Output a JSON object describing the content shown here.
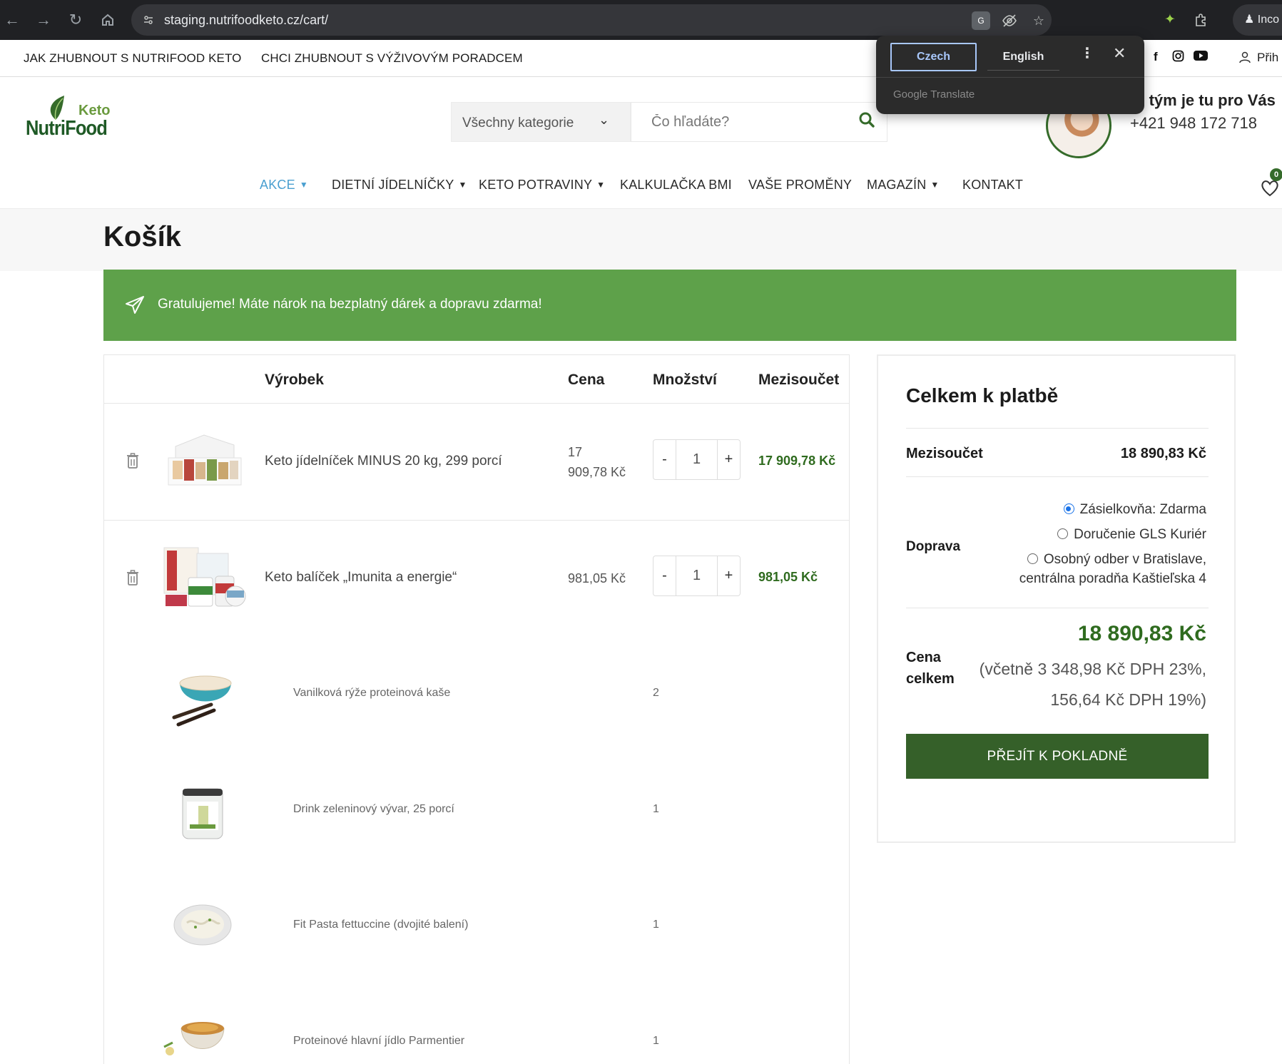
{
  "browser": {
    "url": "staging.nutrifoodketo.cz/cart/",
    "profile_label": "Inco"
  },
  "topbar": {
    "links": [
      "JAK ZHUBNOUT S NUTRIFOOD KETO",
      "CHCI ZHUBNOUT S VÝŽIVOVÝM PORADCEM"
    ],
    "login_label": "Přih"
  },
  "translate_popup": {
    "source_lang": "Czech",
    "target_lang": "English",
    "brand": "Google Translate"
  },
  "header": {
    "logo_keto": "Keto",
    "logo_brand": "NutriFood",
    "category_select": "Všechny kategorie",
    "search_placeholder": "Čo hľadáte?",
    "team_text": "aš tým je tu pro Vás",
    "phone": "+421 948 172 718",
    "wishlist_count": "0"
  },
  "nav": {
    "items": [
      {
        "label": "AKCE",
        "dropdown": true,
        "active": true
      },
      {
        "label": "DIETNÍ JÍDELNÍČKY",
        "dropdown": true
      },
      {
        "label": "KETO POTRAVINY",
        "dropdown": true
      },
      {
        "label": "KALKULAČKA BMI"
      },
      {
        "label": "VAŠE PROMĚNY"
      },
      {
        "label": "MAGAZÍN",
        "dropdown": true
      },
      {
        "label": "KONTAKT"
      }
    ]
  },
  "page": {
    "title": "Košík",
    "notice": "Gratulujeme! Máte nárok na bezplatný dárek a dopravu zdarma!"
  },
  "cart": {
    "headers": {
      "product": "Výrobek",
      "price": "Cena",
      "quantity": "Množství",
      "subtotal": "Mezisoučet"
    },
    "items": [
      {
        "name": "Keto jídelníček MINUS 20 kg, 299 porcí",
        "price_line1": "17",
        "price_line2": "909,78 Kč",
        "qty": "1",
        "subtotal": "17 909,78 Kč"
      },
      {
        "name": "Keto balíček „Imunita a energie“",
        "price": "981,05 Kč",
        "qty": "1",
        "subtotal": "981,05 Kč"
      }
    ],
    "bundle_items": [
      {
        "name": "Vanilková rýže proteinová kaše",
        "qty": "2"
      },
      {
        "name": "Drink zeleninový vývar, 25 porcí",
        "qty": "1"
      },
      {
        "name": "Fit Pasta fettuccine (dvojité balení)",
        "qty": "1"
      },
      {
        "name": "Proteinové hlavní jídlo Parmentier",
        "qty": "1"
      }
    ]
  },
  "totals": {
    "heading": "Celkem k platbě",
    "subtotal_label": "Mezisoučet",
    "subtotal_value": "18 890,83 Kč",
    "shipping_label": "Doprava",
    "shipping_options": [
      {
        "label": "Zásielkovňa: Zdarma",
        "checked": true
      },
      {
        "label": "Doručenie GLS Kuriér",
        "checked": false
      },
      {
        "label": "Osobný odber v Bratislave,",
        "label2": "centrálna poradňa Kaštieľska 4",
        "checked": false
      }
    ],
    "total_label_1": "Cena",
    "total_label_2": "celkem",
    "total_value": "18 890,83 Kč",
    "vat_1": "(včetně 3 348,98 Kč DPH 23%,",
    "vat_2": "156,64 Kč DPH 19%)",
    "checkout_label": "PŘEJÍT K POKLADNĚ"
  },
  "colors": {
    "brand_green": "#356029",
    "notice_green": "#5ea14a",
    "price_green": "#2f6b1f",
    "nav_active": "#4a9fd0"
  }
}
